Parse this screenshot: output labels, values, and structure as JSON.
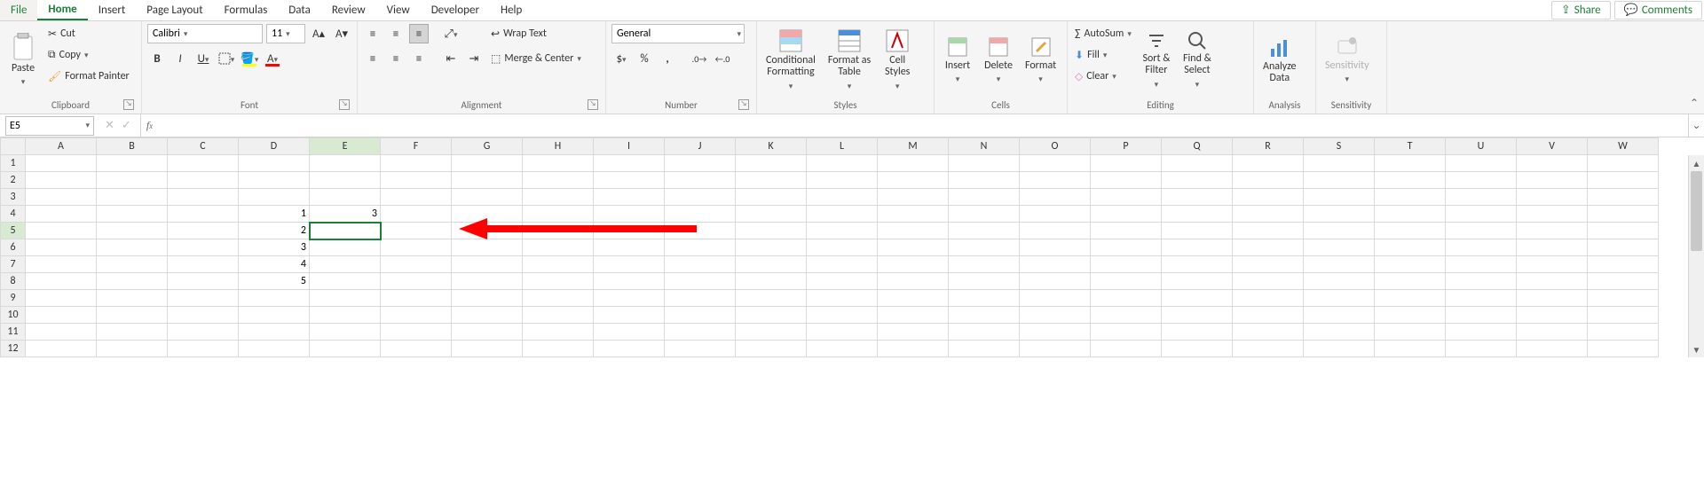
{
  "tabs": {
    "file": "File",
    "items": [
      "Home",
      "Insert",
      "Page Layout",
      "Formulas",
      "Data",
      "Review",
      "View",
      "Developer",
      "Help"
    ],
    "active": "Home",
    "share": "Share",
    "comments": "Comments"
  },
  "ribbon": {
    "clipboard": {
      "paste": "Paste",
      "cut": "Cut",
      "copy": "Copy",
      "format_painter": "Format Painter",
      "label": "Clipboard"
    },
    "font": {
      "name": "Calibri",
      "size": "11",
      "label": "Font"
    },
    "alignment": {
      "wrap": "Wrap Text",
      "merge": "Merge & Center",
      "label": "Alignment"
    },
    "number": {
      "format": "General",
      "label": "Number"
    },
    "styles": {
      "conditional": "Conditional\nFormatting",
      "table": "Format as\nTable",
      "cell": "Cell\nStyles",
      "label": "Styles"
    },
    "cells": {
      "insert": "Insert",
      "delete": "Delete",
      "format": "Format",
      "label": "Cells"
    },
    "editing": {
      "autosum": "AutoSum",
      "fill": "Fill",
      "clear": "Clear",
      "sort": "Sort &\nFilter",
      "find": "Find &\nSelect",
      "label": "Editing"
    },
    "analysis": {
      "analyze": "Analyze\nData",
      "label": "Analysis"
    },
    "sensitivity": {
      "btn": "Sensitivity",
      "label": "Sensitivity"
    }
  },
  "namebox": "E5",
  "columns": [
    "A",
    "B",
    "C",
    "D",
    "E",
    "F",
    "G",
    "H",
    "I",
    "J",
    "K",
    "L",
    "M",
    "N",
    "O",
    "P",
    "Q",
    "R",
    "S",
    "T",
    "U",
    "V",
    "W"
  ],
  "rows": [
    1,
    2,
    3,
    4,
    5,
    6,
    7,
    8,
    9,
    10,
    11,
    12
  ],
  "selected_cell": {
    "row": 5,
    "col": "E"
  },
  "cell_data": {
    "D4": "1",
    "D5": "2",
    "D6": "3",
    "D7": "4",
    "D8": "5",
    "E4": "3"
  },
  "chart_data": null
}
